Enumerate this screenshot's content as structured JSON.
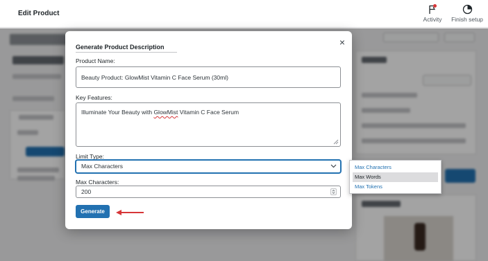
{
  "topbar": {
    "title": "Edit Product",
    "activity_label": "Activity",
    "finish_setup_label": "Finish setup"
  },
  "modal": {
    "title": "Generate Product Description",
    "product_name_label": "Product Name:",
    "product_name_value": "Beauty Product: GlowMist Vitamin C Face Serum (30ml)",
    "key_features_label": "Key Features:",
    "key_features_prefix": "Illuminate Your Beauty with ",
    "key_features_misspelled": "GlowMist",
    "key_features_suffix": " Vitamin C Face Serum",
    "limit_type_label": "Limit Type:",
    "limit_type_selected": "Max Characters",
    "max_characters_label": "Max Characters:",
    "max_characters_value": "200",
    "generate_label": "Generate",
    "close_symbol": "×"
  },
  "dropdown": {
    "options": [
      "Max Characters",
      "Max Words",
      "Max Tokens"
    ],
    "highlighted": "Max Words"
  },
  "icons": {
    "activity": "flag-icon",
    "finish_setup": "progress-circle-icon",
    "close": "close-icon",
    "select": "chevron-down-icon",
    "annotation": "red-arrow-icon"
  },
  "colors": {
    "accent": "#2271b1",
    "annotation_arrow": "#d63638",
    "activity_badge": "#d63638"
  }
}
